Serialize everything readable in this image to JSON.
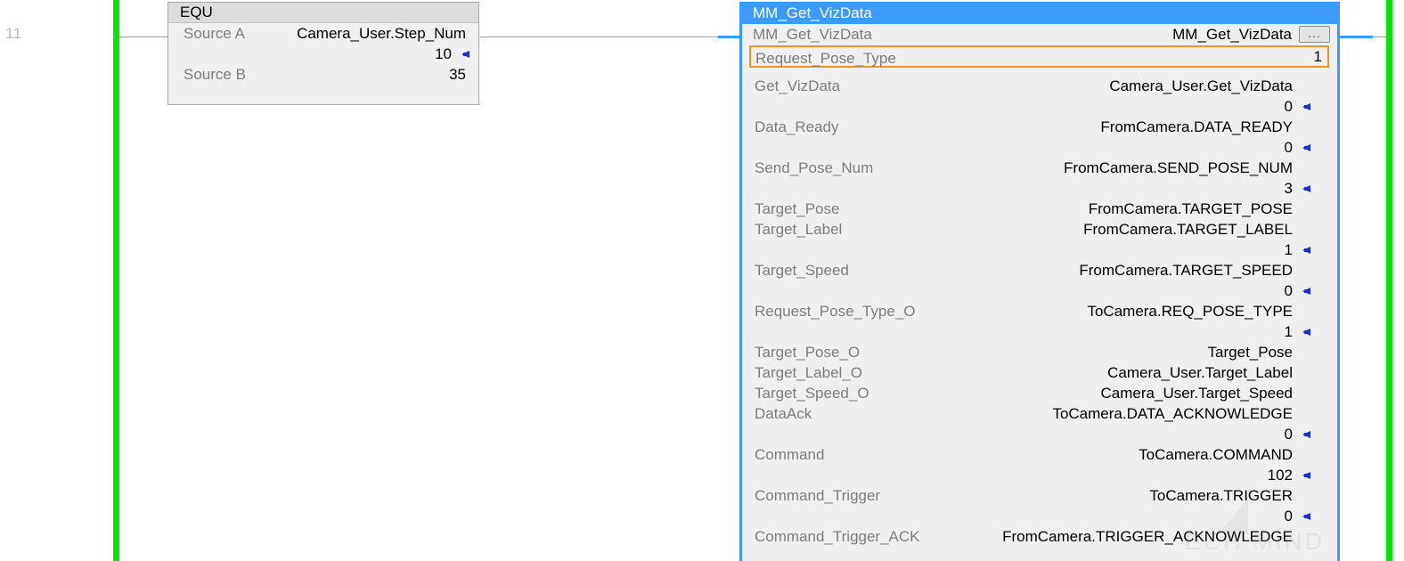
{
  "rung": {
    "number": "11"
  },
  "colors": {
    "rail": "#00e800",
    "wire": "#9a9a9a",
    "block_border": "#3d9bf5",
    "title_bar": "#3d9bf5",
    "selected_outline": "#f0921e",
    "value_marker": "#1f2ed0",
    "body_background": "#efefef"
  },
  "equ": {
    "header": "EQU",
    "rows": [
      {
        "name": "Source A",
        "operand": "Camera_User.Step_Num",
        "value": "10",
        "has_marker": true
      },
      {
        "name": "Source B",
        "operand": "",
        "value": "35",
        "has_marker": false
      }
    ]
  },
  "aoi": {
    "title": "MM_Get_VizData",
    "instance_label": "MM_Get_VizData",
    "instance_value": "MM_Get_VizData",
    "ellipsis_button": "...",
    "selected_parameter": {
      "name": "Request_Pose_Type",
      "value": "1"
    },
    "parameters": [
      {
        "name": "Get_VizData",
        "tag": "Camera_User.Get_VizData",
        "value": "0",
        "has_marker": true
      },
      {
        "name": "Data_Ready",
        "tag": "FromCamera.DATA_READY",
        "value": "0",
        "has_marker": true
      },
      {
        "name": "Send_Pose_Num",
        "tag": "FromCamera.SEND_POSE_NUM",
        "value": "3",
        "has_marker": true
      },
      {
        "name": "Target_Pose",
        "tag": "FromCamera.TARGET_POSE",
        "value": "",
        "has_marker": false
      },
      {
        "name": "Target_Label",
        "tag": "FromCamera.TARGET_LABEL",
        "value": "1",
        "has_marker": true
      },
      {
        "name": "Target_Speed",
        "tag": "FromCamera.TARGET_SPEED",
        "value": "0",
        "has_marker": true
      },
      {
        "name": "Request_Pose_Type_O",
        "tag": "ToCamera.REQ_POSE_TYPE",
        "value": "1",
        "has_marker": true
      },
      {
        "name": "Target_Pose_O",
        "tag": "Target_Pose",
        "value": "",
        "has_marker": false
      },
      {
        "name": "Target_Label_O",
        "tag": "Camera_User.Target_Label",
        "value": "",
        "has_marker": false
      },
      {
        "name": "Target_Speed_O",
        "tag": "Camera_User.Target_Speed",
        "value": "",
        "has_marker": false
      },
      {
        "name": "DataAck",
        "tag": "ToCamera.DATA_ACKNOWLEDGE",
        "value": "0",
        "has_marker": true
      },
      {
        "name": "Command",
        "tag": "ToCamera.COMMAND",
        "value": "102",
        "has_marker": true
      },
      {
        "name": "Command_Trigger",
        "tag": "ToCamera.TRIGGER",
        "value": "0",
        "has_marker": true
      },
      {
        "name": "Command_Trigger_ACK",
        "tag": "FromCamera.TRIGGER_ACKNOWLEDGE",
        "value": "",
        "has_marker": false
      }
    ]
  },
  "watermark": {
    "text": "ECH MIND"
  }
}
